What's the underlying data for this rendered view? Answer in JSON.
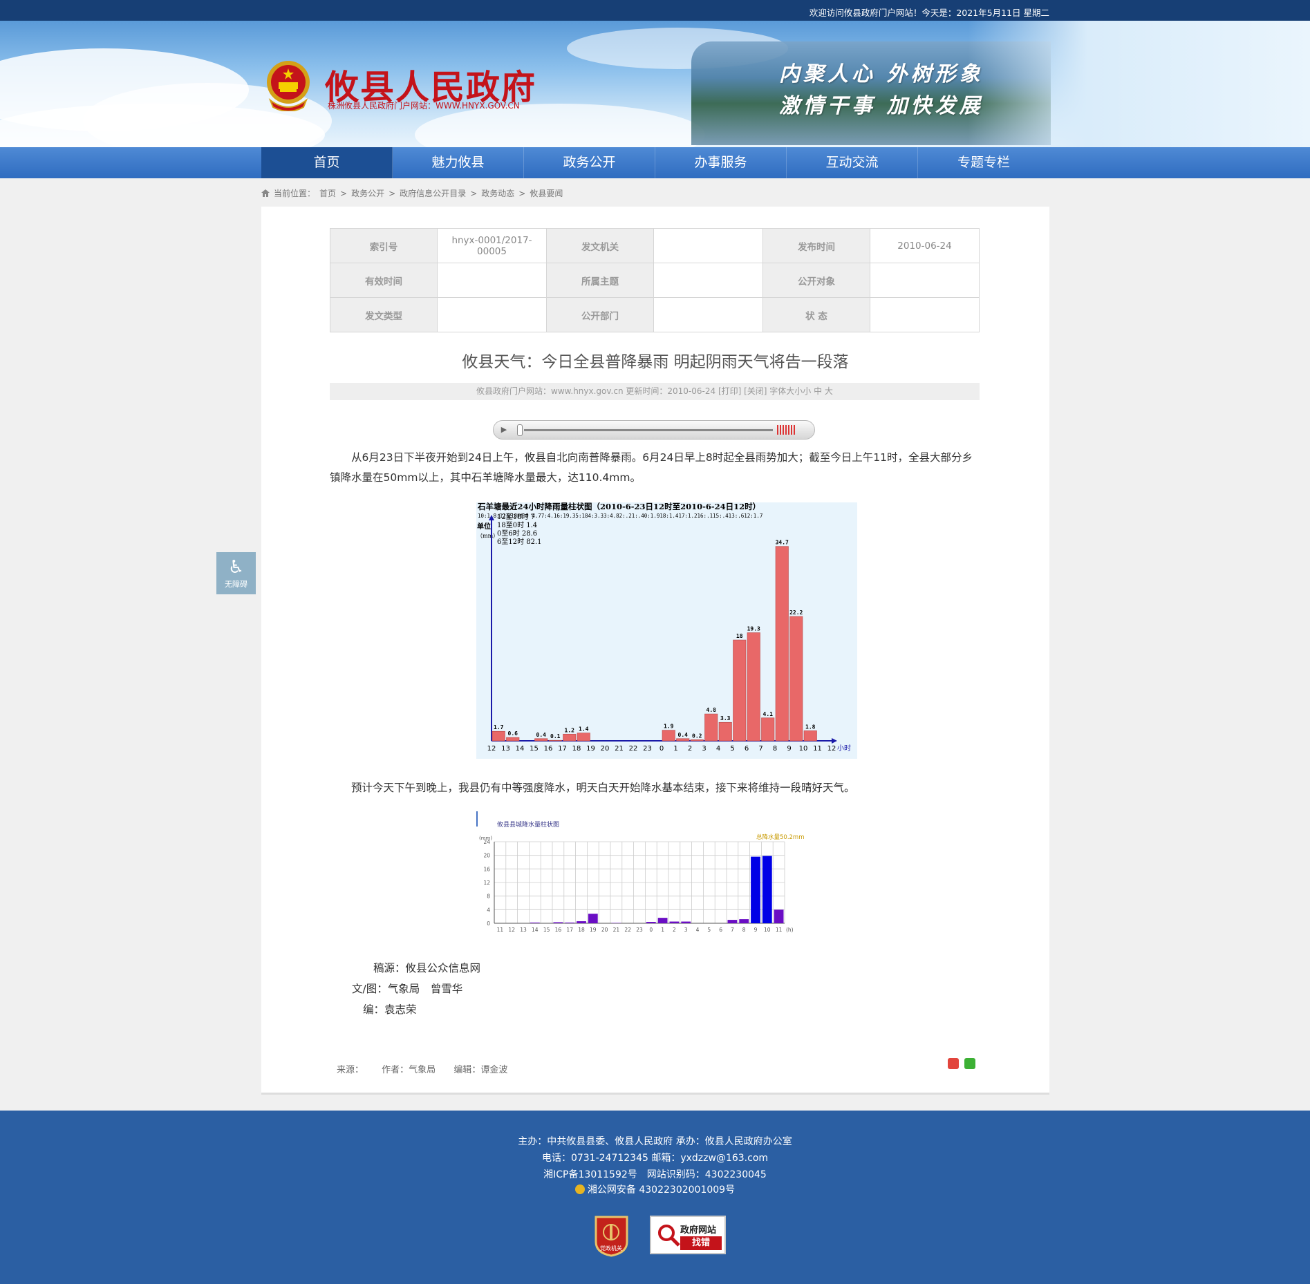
{
  "topbar": {
    "welcome": "欢迎访问攸县政府门户网站！今天是：2021年5月11日 星期二"
  },
  "header": {
    "site_title": "攸县人民政府",
    "site_subtitle": "株洲攸县人民政府门户网站：WWW.HNYX.GOV.CN",
    "slogan_line1": "内聚人心 外树形象",
    "slogan_line2": "激情干事 加快发展"
  },
  "nav": {
    "items": [
      {
        "label": "首页"
      },
      {
        "label": "魅力攸县"
      },
      {
        "label": "政务公开"
      },
      {
        "label": "办事服务"
      },
      {
        "label": "互动交流"
      },
      {
        "label": "专题专栏"
      }
    ]
  },
  "breadcrumb": {
    "prefix": "当前位置：",
    "items": [
      "首页",
      "政务公开",
      "政府信息公开目录",
      "政务动态",
      "攸县要闻"
    ],
    "sep": ">"
  },
  "meta": {
    "index_label": "索引号",
    "index_value": "hnyx-0001/2017-00005",
    "issuer_label": "发文机关",
    "issuer_value": "",
    "date_label": "发布时间",
    "date_value": "2010-06-24",
    "valid_label": "有效时间",
    "valid_value": "",
    "topic_label": "所属主题",
    "topic_value": "",
    "audience_label": "公开对象",
    "audience_value": "",
    "type_label": "发文类型",
    "type_value": "",
    "dept_label": "公开部门",
    "dept_value": "",
    "status_label": "状 态",
    "status_value": ""
  },
  "article": {
    "title": "攸县天气：今日全县普降暴雨 明起阴雨天气将告一段落",
    "info": "攸县政府门户网站：www.hnyx.gov.cn   更新时间：2010-06-24   [打印] [关闭]   字体大小小 中 大",
    "para1": "从6月23日下半夜开始到24日上午，攸县自北向南普降暴雨。6月24日早上8时起全县雨势加大；截至今日上午11时，全县大部分乡镇降水量在50mm以上，其中石羊塘降水量最大，达110.4mm。",
    "para2": "预计今天下午到晚上，我县仍有中等强度降水，明天白天开始降水基本结束，接下来将维持一段晴好天气。",
    "credit_source": "稿源：攸县公众信息网",
    "credit_author": "文/图：气象局　曾雪华",
    "credit_editor": "编：袁志荣",
    "footer_source": "来源：",
    "footer_author": "作者：气象局",
    "footer_editor": "编辑：谭金波"
  },
  "a11y": {
    "label": "无障碍"
  },
  "footer": {
    "line1": "主办：中共攸县县委、攸县人民政府 承办：攸县人民政府办公室",
    "line2": "电话：0731-24712345 邮箱：yxdzzw@163.com",
    "line3": "湘ICP备13011592号　网站识别码：4302230045",
    "line4": "湘公网安备 43022302001009号",
    "badge1": "党政机关",
    "badge2_top": "政府网站",
    "badge2_bottom": "找错"
  },
  "colors": {
    "topbar": "#173f75",
    "nav": "#2f6cc0",
    "nav_active": "#1c4f94",
    "title_red": "#c4131a",
    "footer": "#2b5fa3",
    "bar_red": "#e86868",
    "bar_blue": "#0000e6",
    "bar_purple": "#6a0dc4"
  },
  "chart_data": [
    {
      "type": "bar",
      "title": "石羊塘最近24小时降雨量柱状图（2010-6-23日12时至2010-6-24日12时）",
      "note": "10:1.8;12至18时 0 4.77:4.16:19.35:184:3.33:4.82:.21:.40:1.918:1.417:1.216:.115:.413:.612:1.7",
      "legend_lines": [
        "12至18时 7",
        "18至0时  1.4",
        "0至6时  28.6",
        "6至12时  82.1"
      ],
      "ylabel": "单位（mm）",
      "xlabel": "小时",
      "categories": [
        "12",
        "13",
        "14",
        "15",
        "16",
        "17",
        "18",
        "19",
        "20",
        "21",
        "22",
        "23",
        "0",
        "1",
        "2",
        "3",
        "4",
        "5",
        "6",
        "7",
        "8",
        "9",
        "10",
        "11"
      ],
      "x_end_label": "12",
      "values": [
        1.7,
        0.6,
        0,
        0.4,
        0.1,
        1.2,
        1.4,
        0,
        0,
        0,
        0,
        0,
        1.9,
        0.4,
        0.2,
        4.8,
        3.3,
        18,
        19.3,
        4.1,
        34.7,
        22.2,
        1.8,
        0
      ],
      "labels": [
        "1.7",
        "0.6",
        "",
        "0.4",
        "0.1",
        "1.2",
        "1.4",
        "",
        "",
        "",
        "",
        "",
        "1.9",
        "0.4",
        "0.2",
        "4.8",
        "3.3",
        "18",
        "19.3",
        "4.1",
        "34.7",
        "22.2",
        "1.8",
        ""
      ],
      "ylim": [
        0,
        37
      ]
    },
    {
      "type": "bar",
      "title": "攸县县城降水量柱状图",
      "annotation": "总降水量50.2mm",
      "ylabel": "(mm)",
      "xlabel": "(h)",
      "yticks": [
        0,
        4,
        8,
        12,
        16,
        20,
        24
      ],
      "ylim": [
        0,
        24
      ],
      "grid": true,
      "categories": [
        "11",
        "12",
        "13",
        "14",
        "15",
        "16",
        "17",
        "18",
        "19",
        "20",
        "21",
        "22",
        "23",
        "0",
        "1",
        "2",
        "3",
        "4",
        "5",
        "6",
        "7",
        "8",
        "9",
        "10",
        "11"
      ],
      "values": [
        0,
        0,
        0,
        0.2,
        0,
        0.3,
        0.2,
        0.6,
        2.8,
        0,
        0.1,
        0,
        0,
        0.4,
        1.6,
        0.5,
        0.5,
        0,
        0,
        0,
        1.0,
        1.2,
        19.6,
        19.8,
        4.0
      ]
    }
  ]
}
